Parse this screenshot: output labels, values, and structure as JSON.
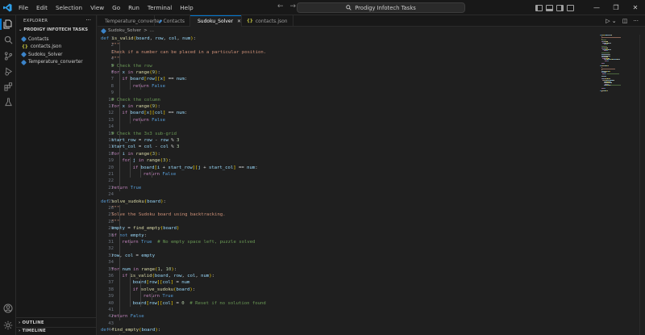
{
  "menu": [
    "File",
    "Edit",
    "Selection",
    "View",
    "Go",
    "Run",
    "Terminal",
    "Help"
  ],
  "command_center": {
    "label": "Prodigy Infotech Tasks"
  },
  "sidebar": {
    "header": "EXPLORER",
    "folder": "PRODIGY INFOTECH TASKS",
    "files": [
      {
        "name": "Contacts",
        "icon": "python-icon"
      },
      {
        "name": "contacts.json",
        "icon": "json-icon"
      },
      {
        "name": "Sudoku_Solver",
        "icon": "python-icon"
      },
      {
        "name": "Temperature_converter",
        "icon": "python-icon"
      }
    ],
    "sections": [
      "OUTLINE",
      "TIMELINE"
    ]
  },
  "tabs": [
    {
      "label": "Temperature_converter",
      "active": false,
      "icon": "python-icon"
    },
    {
      "label": "Contacts",
      "active": false,
      "icon": "python-icon"
    },
    {
      "label": "Sudoku_Solver",
      "active": true,
      "icon": "python-icon"
    },
    {
      "label": "contacts.json",
      "active": false,
      "icon": "json-icon"
    }
  ],
  "breadcrumb": {
    "file": "Sudoku_Solver",
    "separator": ">",
    "rest": "..."
  },
  "colors": {
    "accent": "#0078d4",
    "editor_bg": "#1f1f1f",
    "chrome_bg": "#181818"
  },
  "code": {
    "lines": [
      {
        "indent": 0,
        "tokens": [
          [
            "kw",
            "def "
          ],
          [
            "fn",
            "is_valid"
          ],
          [
            "br1",
            "("
          ],
          [
            "var",
            "board"
          ],
          [
            "pl",
            ", "
          ],
          [
            "var",
            "row"
          ],
          [
            "pl",
            ", "
          ],
          [
            "var",
            "col"
          ],
          [
            "pl",
            ", "
          ],
          [
            "var",
            "num"
          ],
          [
            "br1",
            ")"
          ],
          [
            "pl",
            ":"
          ]
        ]
      },
      {
        "indent": 1,
        "tokens": [
          [
            "str",
            "\"\"\""
          ]
        ]
      },
      {
        "indent": 1,
        "tokens": [
          [
            "str",
            "Check if a number can be placed in a particular position."
          ]
        ]
      },
      {
        "indent": 1,
        "tokens": [
          [
            "str",
            "\"\"\""
          ]
        ]
      },
      {
        "indent": 1,
        "tokens": [
          [
            "cmt",
            "# Check the row"
          ]
        ]
      },
      {
        "indent": 1,
        "tokens": [
          [
            "ctl",
            "for "
          ],
          [
            "var",
            "x"
          ],
          [
            "ctl",
            " in "
          ],
          [
            "fn",
            "range"
          ],
          [
            "br1",
            "("
          ],
          [
            "num",
            "9"
          ],
          [
            "br1",
            ")"
          ],
          [
            "pl",
            ":"
          ]
        ]
      },
      {
        "indent": 2,
        "tokens": [
          [
            "ctl",
            "if "
          ],
          [
            "var",
            "board"
          ],
          [
            "br1",
            "["
          ],
          [
            "var",
            "row"
          ],
          [
            "br1",
            "]"
          ],
          [
            "br1",
            "["
          ],
          [
            "var",
            "x"
          ],
          [
            "br1",
            "]"
          ],
          [
            "pl",
            " == "
          ],
          [
            "var",
            "num"
          ],
          [
            "pl",
            ":"
          ]
        ]
      },
      {
        "indent": 3,
        "tokens": [
          [
            "ctl",
            "return "
          ],
          [
            "kw",
            "False"
          ]
        ]
      },
      {
        "indent": 0,
        "tokens": []
      },
      {
        "indent": 1,
        "tokens": [
          [
            "cmt",
            "# Check the column"
          ]
        ]
      },
      {
        "indent": 1,
        "tokens": [
          [
            "ctl",
            "for "
          ],
          [
            "var",
            "x"
          ],
          [
            "ctl",
            " in "
          ],
          [
            "fn",
            "range"
          ],
          [
            "br1",
            "("
          ],
          [
            "num",
            "9"
          ],
          [
            "br1",
            ")"
          ],
          [
            "pl",
            ":"
          ]
        ]
      },
      {
        "indent": 2,
        "tokens": [
          [
            "ctl",
            "if "
          ],
          [
            "var",
            "board"
          ],
          [
            "br1",
            "["
          ],
          [
            "var",
            "x"
          ],
          [
            "br1",
            "]"
          ],
          [
            "br1",
            "["
          ],
          [
            "var",
            "col"
          ],
          [
            "br1",
            "]"
          ],
          [
            "pl",
            " == "
          ],
          [
            "var",
            "num"
          ],
          [
            "pl",
            ":"
          ]
        ]
      },
      {
        "indent": 3,
        "tokens": [
          [
            "ctl",
            "return "
          ],
          [
            "kw",
            "False"
          ]
        ]
      },
      {
        "indent": 0,
        "tokens": []
      },
      {
        "indent": 1,
        "tokens": [
          [
            "cmt",
            "# Check the 3x3 sub-grid"
          ]
        ]
      },
      {
        "indent": 1,
        "tokens": [
          [
            "var",
            "start_row"
          ],
          [
            "pl",
            " = "
          ],
          [
            "var",
            "row"
          ],
          [
            "pl",
            " - "
          ],
          [
            "var",
            "row"
          ],
          [
            "pl",
            " % "
          ],
          [
            "num",
            "3"
          ]
        ]
      },
      {
        "indent": 1,
        "tokens": [
          [
            "var",
            "start_col"
          ],
          [
            "pl",
            " = "
          ],
          [
            "var",
            "col"
          ],
          [
            "pl",
            " - "
          ],
          [
            "var",
            "col"
          ],
          [
            "pl",
            " % "
          ],
          [
            "num",
            "3"
          ]
        ]
      },
      {
        "indent": 1,
        "tokens": [
          [
            "ctl",
            "for "
          ],
          [
            "var",
            "i"
          ],
          [
            "ctl",
            " in "
          ],
          [
            "fn",
            "range"
          ],
          [
            "br1",
            "("
          ],
          [
            "num",
            "3"
          ],
          [
            "br1",
            ")"
          ],
          [
            "pl",
            ":"
          ]
        ]
      },
      {
        "indent": 2,
        "tokens": [
          [
            "ctl",
            "for "
          ],
          [
            "var",
            "j"
          ],
          [
            "ctl",
            " in "
          ],
          [
            "fn",
            "range"
          ],
          [
            "br1",
            "("
          ],
          [
            "num",
            "3"
          ],
          [
            "br1",
            ")"
          ],
          [
            "pl",
            ":"
          ]
        ]
      },
      {
        "indent": 3,
        "tokens": [
          [
            "ctl",
            "if "
          ],
          [
            "var",
            "board"
          ],
          [
            "br1",
            "["
          ],
          [
            "var",
            "i"
          ],
          [
            "pl",
            " + "
          ],
          [
            "var",
            "start_row"
          ],
          [
            "br1",
            "]"
          ],
          [
            "br1",
            "["
          ],
          [
            "var",
            "j"
          ],
          [
            "pl",
            " + "
          ],
          [
            "var",
            "start_col"
          ],
          [
            "br1",
            "]"
          ],
          [
            "pl",
            " == "
          ],
          [
            "var",
            "num"
          ],
          [
            "pl",
            ":"
          ]
        ]
      },
      {
        "indent": 4,
        "tokens": [
          [
            "ctl",
            "return "
          ],
          [
            "kw",
            "False"
          ]
        ]
      },
      {
        "indent": 0,
        "tokens": []
      },
      {
        "indent": 1,
        "tokens": [
          [
            "ctl",
            "return "
          ],
          [
            "kw",
            "True"
          ]
        ]
      },
      {
        "indent": 0,
        "tokens": []
      },
      {
        "indent": 0,
        "tokens": [
          [
            "kw",
            "def "
          ],
          [
            "fn",
            "solve_sudoku"
          ],
          [
            "br1",
            "("
          ],
          [
            "var",
            "board"
          ],
          [
            "br1",
            ")"
          ],
          [
            "pl",
            ":"
          ]
        ]
      },
      {
        "indent": 1,
        "tokens": [
          [
            "str",
            "\"\"\""
          ]
        ]
      },
      {
        "indent": 1,
        "tokens": [
          [
            "str",
            "Solve the Sudoku board using backtracking."
          ]
        ]
      },
      {
        "indent": 1,
        "tokens": [
          [
            "str",
            "\"\"\""
          ]
        ]
      },
      {
        "indent": 1,
        "tokens": [
          [
            "var",
            "empty"
          ],
          [
            "pl",
            " = "
          ],
          [
            "fn",
            "find_empty"
          ],
          [
            "br1",
            "("
          ],
          [
            "var",
            "board"
          ],
          [
            "br1",
            ")"
          ]
        ]
      },
      {
        "indent": 1,
        "tokens": [
          [
            "ctl",
            "if "
          ],
          [
            "kw",
            "not "
          ],
          [
            "var",
            "empty"
          ],
          [
            "pl",
            ":"
          ]
        ]
      },
      {
        "indent": 2,
        "tokens": [
          [
            "ctl",
            "return "
          ],
          [
            "kw",
            "True"
          ],
          [
            "pl",
            "  "
          ],
          [
            "cmt",
            "# No empty space left, puzzle solved"
          ]
        ]
      },
      {
        "indent": 0,
        "tokens": []
      },
      {
        "indent": 1,
        "tokens": [
          [
            "var",
            "row"
          ],
          [
            "pl",
            ", "
          ],
          [
            "var",
            "col"
          ],
          [
            "pl",
            " = "
          ],
          [
            "var",
            "empty"
          ]
        ]
      },
      {
        "indent": 0,
        "tokens": []
      },
      {
        "indent": 1,
        "tokens": [
          [
            "ctl",
            "for "
          ],
          [
            "var",
            "num"
          ],
          [
            "ctl",
            " in "
          ],
          [
            "fn",
            "range"
          ],
          [
            "br1",
            "("
          ],
          [
            "num",
            "1"
          ],
          [
            "pl",
            ", "
          ],
          [
            "num",
            "10"
          ],
          [
            "br1",
            ")"
          ],
          [
            "pl",
            ":"
          ]
        ]
      },
      {
        "indent": 2,
        "tokens": [
          [
            "ctl",
            "if "
          ],
          [
            "fn",
            "is_valid"
          ],
          [
            "br1",
            "("
          ],
          [
            "var",
            "board"
          ],
          [
            "pl",
            ", "
          ],
          [
            "var",
            "row"
          ],
          [
            "pl",
            ", "
          ],
          [
            "var",
            "col"
          ],
          [
            "pl",
            ", "
          ],
          [
            "var",
            "num"
          ],
          [
            "br1",
            ")"
          ],
          [
            "pl",
            ":"
          ]
        ]
      },
      {
        "indent": 3,
        "tokens": [
          [
            "var",
            "board"
          ],
          [
            "br1",
            "["
          ],
          [
            "var",
            "row"
          ],
          [
            "br1",
            "]"
          ],
          [
            "br1",
            "["
          ],
          [
            "var",
            "col"
          ],
          [
            "br1",
            "]"
          ],
          [
            "pl",
            " = "
          ],
          [
            "var",
            "num"
          ]
        ]
      },
      {
        "indent": 3,
        "tokens": [
          [
            "ctl",
            "if "
          ],
          [
            "fn",
            "solve_sudoku"
          ],
          [
            "br1",
            "("
          ],
          [
            "var",
            "board"
          ],
          [
            "br1",
            ")"
          ],
          [
            "pl",
            ":"
          ]
        ]
      },
      {
        "indent": 4,
        "tokens": [
          [
            "ctl",
            "return "
          ],
          [
            "kw",
            "True"
          ]
        ]
      },
      {
        "indent": 3,
        "tokens": [
          [
            "var",
            "board"
          ],
          [
            "br1",
            "["
          ],
          [
            "var",
            "row"
          ],
          [
            "br1",
            "]"
          ],
          [
            "br1",
            "["
          ],
          [
            "var",
            "col"
          ],
          [
            "br1",
            "]"
          ],
          [
            "pl",
            " = "
          ],
          [
            "num",
            "0"
          ],
          [
            "pl",
            "  "
          ],
          [
            "cmt",
            "# Reset if no solution found"
          ]
        ]
      },
      {
        "indent": 0,
        "tokens": []
      },
      {
        "indent": 1,
        "tokens": [
          [
            "ctl",
            "return "
          ],
          [
            "kw",
            "False"
          ]
        ]
      },
      {
        "indent": 0,
        "tokens": []
      },
      {
        "indent": 0,
        "tokens": [
          [
            "kw",
            "def "
          ],
          [
            "fn",
            "find_empty"
          ],
          [
            "br1",
            "("
          ],
          [
            "var",
            "board"
          ],
          [
            "br1",
            ")"
          ],
          [
            "pl",
            ":"
          ]
        ]
      },
      {
        "indent": 1,
        "tokens": [
          [
            "str",
            "\"\"\""
          ]
        ]
      }
    ]
  }
}
